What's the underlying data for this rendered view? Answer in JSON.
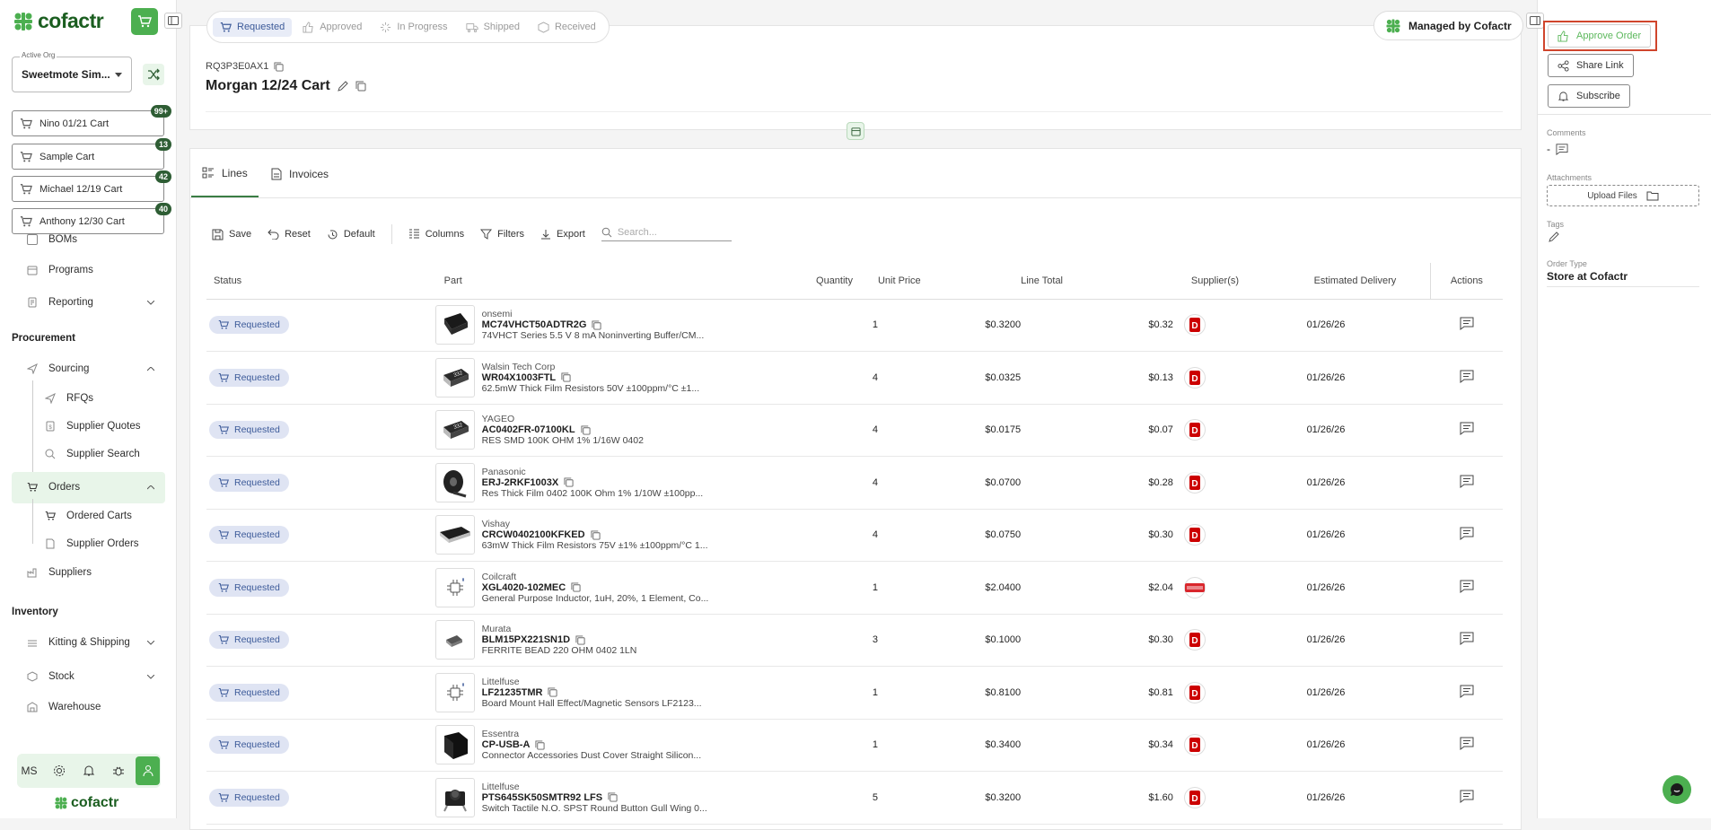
{
  "brand": {
    "name": "cofactr",
    "accent": "#4caf50",
    "dark_green": "#1b5e20"
  },
  "sidebar": {
    "org_label": "Active Org",
    "org_value": "Sweetmote Sim...",
    "carts": [
      {
        "label": "Nino 01/21 Cart",
        "badge": "99+"
      },
      {
        "label": "Sample Cart",
        "badge": "13"
      },
      {
        "label": "Michael 12/19 Cart",
        "badge": "42"
      },
      {
        "label": "Anthony 12/30 Cart",
        "badge": "40"
      }
    ],
    "nav": {
      "boms": "BOMs",
      "programs": "Programs",
      "reporting": "Reporting",
      "procurement": "Procurement",
      "sourcing": "Sourcing",
      "rfqs": "RFQs",
      "supplier_quotes": "Supplier Quotes",
      "supplier_search": "Supplier Search",
      "orders": "Orders",
      "ordered_carts": "Ordered Carts",
      "supplier_orders": "Supplier Orders",
      "suppliers": "Suppliers",
      "inventory": "Inventory",
      "kitting": "Kitting & Shipping",
      "stock": "Stock",
      "warehouse": "Warehouse"
    },
    "user_initials": "MS",
    "footer_logo": "cofactr"
  },
  "status_steps": [
    "Requested",
    "Approved",
    "In Progress",
    "Shipped",
    "Received"
  ],
  "managed_label": "Managed by Cofactr",
  "order": {
    "id": "RQ3P3E0AX1",
    "name": "Morgan 12/24 Cart"
  },
  "tabs": [
    "Lines",
    "Invoices"
  ],
  "toolbar": {
    "save": "Save",
    "reset": "Reset",
    "default": "Default",
    "columns": "Columns",
    "filters": "Filters",
    "export": "Export",
    "search_placeholder": "Search..."
  },
  "columns": [
    "Status",
    "Part",
    "Quantity",
    "Unit Price",
    "Line Total",
    "Supplier(s)",
    "Estimated Delivery",
    "Actions"
  ],
  "rows": [
    {
      "status": "Requested",
      "mfr": "onsemi",
      "pn": "MC74VHCT50ADTR2G",
      "desc": "74VHCT Series 5.5 V 8 mA Noninverting Buffer/CM...",
      "qty": "1",
      "unit": "$0.3200",
      "total": "$0.32",
      "delivery": "01/26/26",
      "supplier": "digikey",
      "thumb": "ic"
    },
    {
      "status": "Requested",
      "mfr": "Walsin Tech Corp",
      "pn": "WR04X1003FTL",
      "desc": "62.5mW Thick Film Resistors 50V ±100ppm/°C ±1...",
      "qty": "4",
      "unit": "$0.0325",
      "total": "$0.13",
      "delivery": "01/26/26",
      "supplier": "digikey",
      "thumb": "res"
    },
    {
      "status": "Requested",
      "mfr": "YAGEO",
      "pn": "AC0402FR-07100KL",
      "desc": "RES SMD 100K OHM 1% 1/16W 0402",
      "qty": "4",
      "unit": "$0.0175",
      "total": "$0.07",
      "delivery": "01/26/26",
      "supplier": "digikey",
      "thumb": "res"
    },
    {
      "status": "Requested",
      "mfr": "Panasonic",
      "pn": "ERJ-2RKF1003X",
      "desc": "Res Thick Film 0402 100K Ohm 1% 1/10W ±100pp...",
      "qty": "4",
      "unit": "$0.0700",
      "total": "$0.28",
      "delivery": "01/26/26",
      "supplier": "digikey",
      "thumb": "reel"
    },
    {
      "status": "Requested",
      "mfr": "Vishay",
      "pn": "CRCW0402100KFKED",
      "desc": "63mW Thick Film Resistors 75V ±1% ±100ppm/°C 1...",
      "qty": "4",
      "unit": "$0.0750",
      "total": "$0.30",
      "delivery": "01/26/26",
      "supplier": "digikey",
      "thumb": "chip"
    },
    {
      "status": "Requested",
      "mfr": "Coilcraft",
      "pn": "XGL4020-102MEC",
      "desc": "General Purpose Inductor, 1uH, 20%, 1 Element, Co...",
      "qty": "1",
      "unit": "$2.0400",
      "total": "$2.04",
      "delivery": "01/26/26",
      "supplier": "coilcraft",
      "thumb": "generic"
    },
    {
      "status": "Requested",
      "mfr": "Murata",
      "pn": "BLM15PX221SN1D",
      "desc": "FERRITE BEAD 220 OHM 0402 1LN",
      "qty": "3",
      "unit": "$0.1000",
      "total": "$0.30",
      "delivery": "01/26/26",
      "supplier": "digikey",
      "thumb": "small"
    },
    {
      "status": "Requested",
      "mfr": "Littelfuse",
      "pn": "LF21235TMR",
      "desc": "Board Mount Hall Effect/Magnetic Sensors LF2123...",
      "qty": "1",
      "unit": "$0.8100",
      "total": "$0.81",
      "delivery": "01/26/26",
      "supplier": "digikey",
      "thumb": "generic"
    },
    {
      "status": "Requested",
      "mfr": "Essentra",
      "pn": "CP-USB-A",
      "desc": "Connector Accessories Dust Cover Straight Silicon...",
      "qty": "1",
      "unit": "$0.3400",
      "total": "$0.34",
      "delivery": "01/26/26",
      "supplier": "digikey",
      "thumb": "usb"
    },
    {
      "status": "Requested",
      "mfr": "Littelfuse",
      "pn": "PTS645SK50SMTR92 LFS",
      "desc": "Switch Tactile N.O. SPST Round Button Gull Wing 0...",
      "qty": "5",
      "unit": "$0.3200",
      "total": "$1.60",
      "delivery": "01/26/26",
      "supplier": "digikey",
      "thumb": "switch"
    }
  ],
  "right_panel": {
    "approve": "Approve Order",
    "share": "Share Link",
    "subscribe": "Subscribe",
    "comments_label": "Comments",
    "comments_value": "-",
    "attachments_label": "Attachments",
    "upload": "Upload Files",
    "tags_label": "Tags",
    "order_type_label": "Order Type",
    "order_type_value": "Store at Cofactr"
  }
}
